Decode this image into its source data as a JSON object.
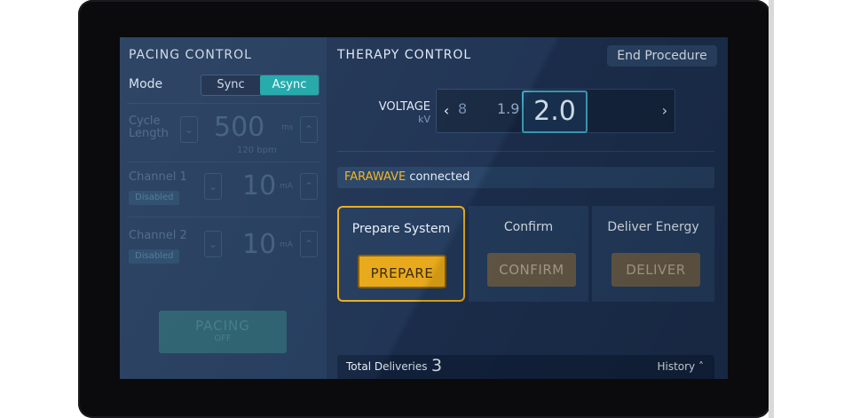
{
  "pacing": {
    "title": "PACING CONTROL",
    "mode_label": "Mode",
    "mode_options": [
      "Sync",
      "Async"
    ],
    "mode_selected": "Async",
    "cycle_length": {
      "label_line1": "Cycle",
      "label_line2": "Length",
      "value": "500",
      "unit": "ms",
      "sub": "120 bpm"
    },
    "channel1": {
      "label": "Channel 1",
      "status": "Disabled",
      "value": "10",
      "unit": "mA"
    },
    "channel2": {
      "label": "Channel 2",
      "status": "Disabled",
      "value": "10",
      "unit": "mA"
    },
    "pacing_button": {
      "label": "PACING",
      "state": "OFF"
    }
  },
  "therapy": {
    "title": "THERAPY CONTROL",
    "end_button": "End Procedure",
    "voltage": {
      "label": "VOLTAGE",
      "unit": "kV",
      "far": "8",
      "near": "1.9",
      "selected": "2.0"
    },
    "status": {
      "brand": "FARAWAVE",
      "text": " connected"
    },
    "steps": [
      {
        "title": "Prepare System",
        "button": "PREPARE"
      },
      {
        "title": "Confirm",
        "button": "CONFIRM"
      },
      {
        "title": "Deliver Energy",
        "button": "DELIVER"
      }
    ],
    "footer": {
      "deliveries_label": "Total Deliveries",
      "deliveries_value": "3",
      "history_label": "History"
    }
  },
  "icons": {
    "left_arrow": "chevron-left-icon",
    "right_arrow": "chevron-right-icon",
    "history_arrow": "chevron-up-icon"
  },
  "colors": {
    "accent_teal": "#1fa7a8",
    "warning_amber": "#e8a817",
    "brand_text": "#f2b31e",
    "selection_border": "#3fa8c6"
  }
}
